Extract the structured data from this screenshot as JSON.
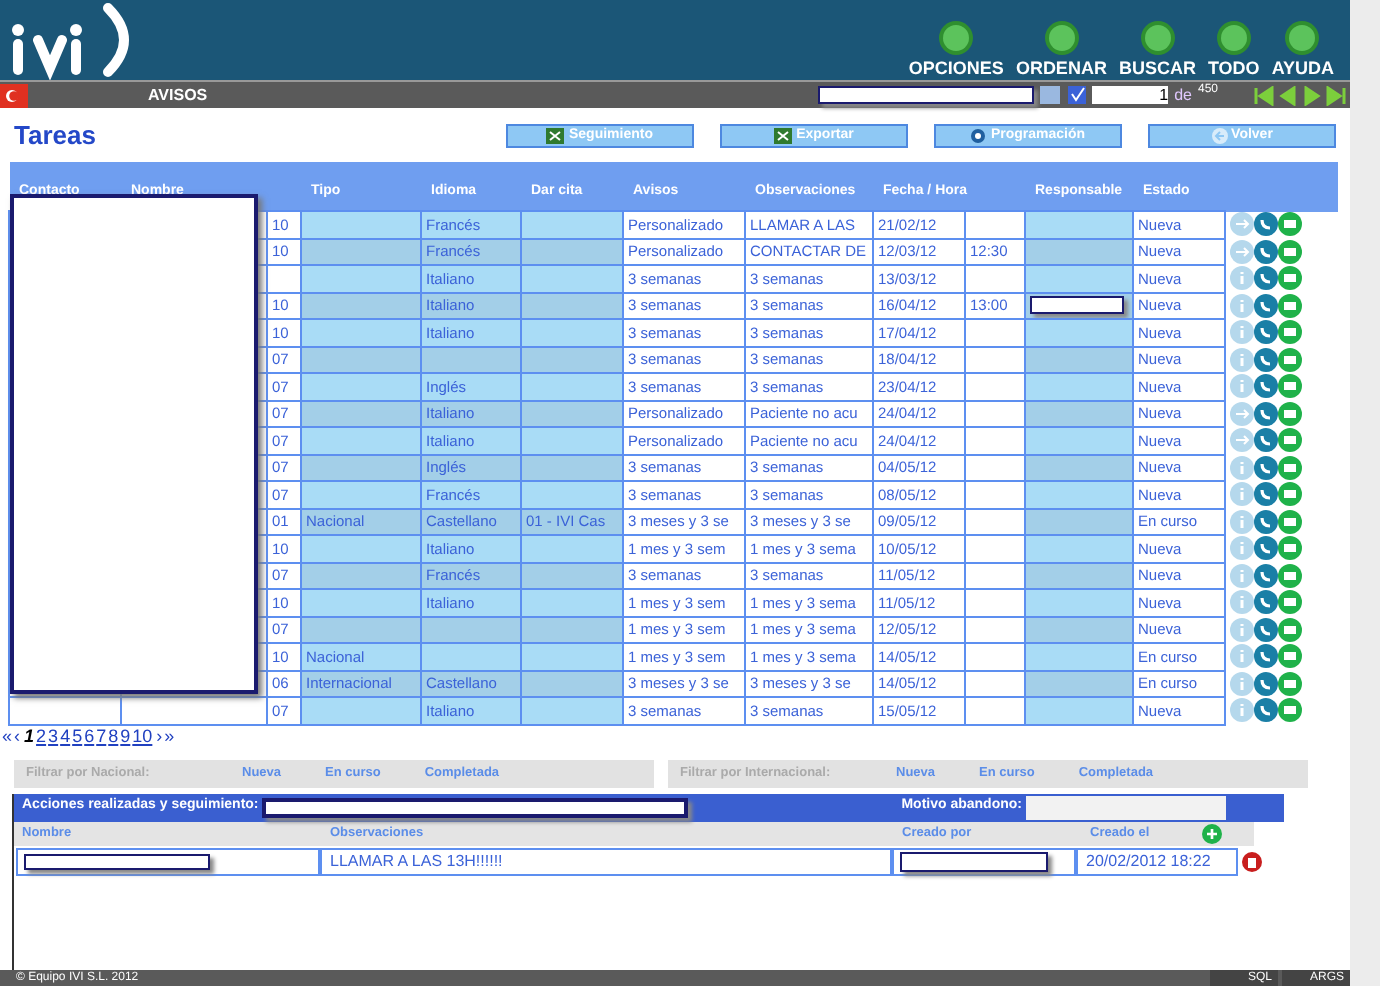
{
  "header": {
    "actions": [
      {
        "label": "OPCIONES"
      },
      {
        "label": "ORDENAR"
      },
      {
        "label": "BUSCAR"
      },
      {
        "label": "TODO"
      },
      {
        "label": "AYUDA"
      }
    ]
  },
  "toolbar": {
    "title": "AVISOS",
    "page": "1",
    "of_label": "de",
    "total": "450"
  },
  "section_title": "Tareas",
  "buttons": [
    {
      "label": "Seguimiento",
      "kind": "excel"
    },
    {
      "label": "Exportar",
      "kind": "excel"
    },
    {
      "label": "Programación",
      "kind": "gear"
    },
    {
      "label": "Volver",
      "kind": "back"
    }
  ],
  "table": {
    "columns": [
      "Contacto",
      "Nombre",
      "",
      "Tipo",
      "Idioma",
      "Dar cita",
      "Avisos",
      "Observaciones",
      "Fecha / Hora",
      "",
      "Responsable",
      "Estado"
    ],
    "rows": [
      {
        "code": "10",
        "tipo": "",
        "idioma": "Francés",
        "dar_cita": "",
        "avisos": "Personalizado",
        "observaciones": "LLAMAR A LAS",
        "fecha": "21/02/12",
        "hora": "",
        "responsable_field": false,
        "estado": "Nueva",
        "kind": "arrow"
      },
      {
        "code": "10",
        "tipo": "",
        "idioma": "Francés",
        "dar_cita": "",
        "avisos": "Personalizado",
        "observaciones": "CONTACTAR DE",
        "fecha": "12/03/12",
        "hora": "12:30",
        "responsable_field": false,
        "estado": "Nueva",
        "kind": "arrow"
      },
      {
        "code": "",
        "tipo": "",
        "idioma": "Italiano",
        "dar_cita": "",
        "avisos": "3 semanas",
        "observaciones": "3 semanas",
        "fecha": "13/03/12",
        "hora": "",
        "responsable_field": false,
        "estado": "Nueva",
        "kind": "info"
      },
      {
        "code": "10",
        "tipo": "",
        "idioma": "Italiano",
        "dar_cita": "",
        "avisos": "3 semanas",
        "observaciones": "3 semanas",
        "fecha": "16/04/12",
        "hora": "13:00",
        "responsable_field": true,
        "estado": "Nueva",
        "kind": "info"
      },
      {
        "code": "10",
        "tipo": "",
        "idioma": "Italiano",
        "dar_cita": "",
        "avisos": "3 semanas",
        "observaciones": "3 semanas",
        "fecha": "17/04/12",
        "hora": "",
        "responsable_field": false,
        "estado": "Nueva",
        "kind": "info"
      },
      {
        "code": "07",
        "tipo": "",
        "idioma": "",
        "dar_cita": "",
        "avisos": "3 semanas",
        "observaciones": "3 semanas",
        "fecha": "18/04/12",
        "hora": "",
        "responsable_field": false,
        "estado": "Nueva",
        "kind": "info"
      },
      {
        "code": "07",
        "tipo": "",
        "idioma": "Inglés",
        "dar_cita": "",
        "avisos": "3 semanas",
        "observaciones": "3 semanas",
        "fecha": "23/04/12",
        "hora": "",
        "responsable_field": false,
        "estado": "Nueva",
        "kind": "info"
      },
      {
        "code": "07",
        "tipo": "",
        "idioma": "Italiano",
        "dar_cita": "",
        "avisos": "Personalizado",
        "observaciones": "Paciente no acu",
        "fecha": "24/04/12",
        "hora": "",
        "responsable_field": false,
        "estado": "Nueva",
        "kind": "arrow"
      },
      {
        "code": "07",
        "tipo": "",
        "idioma": "Italiano",
        "dar_cita": "",
        "avisos": "Personalizado",
        "observaciones": "Paciente no acu",
        "fecha": "24/04/12",
        "hora": "",
        "responsable_field": false,
        "estado": "Nueva",
        "kind": "arrow"
      },
      {
        "code": "07",
        "tipo": "",
        "idioma": "Inglés",
        "dar_cita": "",
        "avisos": "3 semanas",
        "observaciones": "3 semanas",
        "fecha": "04/05/12",
        "hora": "",
        "responsable_field": false,
        "estado": "Nueva",
        "kind": "info"
      },
      {
        "code": "07",
        "tipo": "",
        "idioma": "Francés",
        "dar_cita": "",
        "avisos": "3 semanas",
        "observaciones": "3 semanas",
        "fecha": "08/05/12",
        "hora": "",
        "responsable_field": false,
        "estado": "Nueva",
        "kind": "info"
      },
      {
        "code": "01",
        "tipo": "Nacional",
        "idioma": "Castellano",
        "dar_cita": "01 - IVI Cas",
        "avisos": "3 meses y 3 se",
        "observaciones": "3 meses y 3 se",
        "fecha": "09/05/12",
        "hora": "",
        "responsable_field": false,
        "estado": "En curso",
        "kind": "info"
      },
      {
        "code": "10",
        "tipo": "",
        "idioma": "Italiano",
        "dar_cita": "",
        "avisos": "1 mes y 3 sem",
        "observaciones": "1 mes y 3 sema",
        "fecha": "10/05/12",
        "hora": "",
        "responsable_field": false,
        "estado": "Nueva",
        "kind": "info"
      },
      {
        "code": "07",
        "tipo": "",
        "idioma": "Francés",
        "dar_cita": "",
        "avisos": "3 semanas",
        "observaciones": "3 semanas",
        "fecha": "11/05/12",
        "hora": "",
        "responsable_field": false,
        "estado": "Nueva",
        "kind": "info"
      },
      {
        "code": "10",
        "tipo": "",
        "idioma": "Italiano",
        "dar_cita": "",
        "avisos": "1 mes y 3 sem",
        "observaciones": "1 mes y 3 sema",
        "fecha": "11/05/12",
        "hora": "",
        "responsable_field": false,
        "estado": "Nueva",
        "kind": "info"
      },
      {
        "code": "07",
        "tipo": "",
        "idioma": "",
        "dar_cita": "",
        "avisos": "1 mes y 3 sem",
        "observaciones": "1 mes y 3 sema",
        "fecha": "12/05/12",
        "hora": "",
        "responsable_field": false,
        "estado": "Nueva",
        "kind": "info"
      },
      {
        "code": "10",
        "tipo": "Nacional",
        "idioma": "",
        "dar_cita": "",
        "avisos": "1 mes y 3 sem",
        "observaciones": "1 mes y 3 sema",
        "fecha": "14/05/12",
        "hora": "",
        "responsable_field": false,
        "estado": "En curso",
        "kind": "info"
      },
      {
        "code": "06",
        "tipo": "Internacional",
        "idioma": "Castellano",
        "dar_cita": "",
        "avisos": "3 meses y 3 se",
        "observaciones": "3 meses y 3 se",
        "fecha": "14/05/12",
        "hora": "",
        "responsable_field": false,
        "estado": "En curso",
        "kind": "info"
      },
      {
        "code": "07",
        "tipo": "",
        "idioma": "Italiano",
        "dar_cita": "",
        "avisos": "3 semanas",
        "observaciones": "3 semanas",
        "fecha": "15/05/12",
        "hora": "",
        "responsable_field": false,
        "estado": "Nueva",
        "kind": "info"
      }
    ]
  },
  "pagination": {
    "first": "«",
    "prev": "‹",
    "pages": [
      {
        "label": "1",
        "selected": true
      },
      {
        "label": "2",
        "selected": false
      },
      {
        "label": "3",
        "selected": false
      },
      {
        "label": "4",
        "selected": false
      },
      {
        "label": "5",
        "selected": false
      },
      {
        "label": "6",
        "selected": false
      },
      {
        "label": "7",
        "selected": false
      },
      {
        "label": "8",
        "selected": false
      },
      {
        "label": "9",
        "selected": false
      },
      {
        "label": "10",
        "selected": false
      }
    ],
    "next": "›",
    "last": "»"
  },
  "filters": [
    {
      "label": "Filtrar por Nacional:",
      "options": [
        "Nueva",
        "En curso",
        "Completada"
      ]
    },
    {
      "label": "Filtrar por Internacional:",
      "options": [
        "Nueva",
        "En curso",
        "Completada"
      ]
    }
  ],
  "actions_panel": {
    "title": "Acciones realizadas y seguimiento:",
    "reason_label": "Motivo abandono:",
    "columns": [
      "Nombre",
      "Observaciones",
      "Creado por",
      "Creado el"
    ],
    "rows": [
      {
        "observaciones": "LLAMAR A LAS 13H!!!!!!",
        "creado_el": "20/02/2012 18:22"
      }
    ]
  },
  "footer": {
    "copyright": "© Equipo IVI S.L. 2012",
    "buttons": [
      "SQL",
      "ARGS"
    ]
  }
}
